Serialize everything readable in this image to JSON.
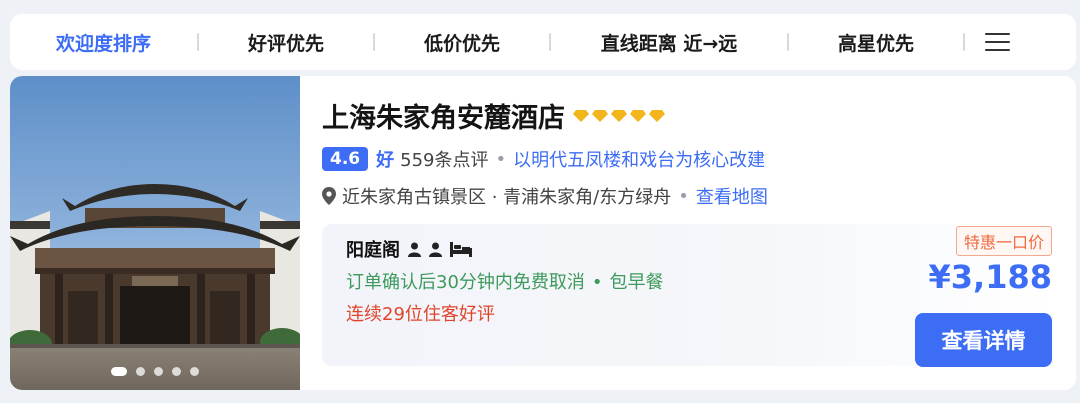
{
  "sort_bar": {
    "items": [
      {
        "label": "欢迎度排序",
        "active": true
      },
      {
        "label": "好评优先",
        "active": false
      },
      {
        "label": "低价优先",
        "active": false
      },
      {
        "label": "直线距离 近→远",
        "active": false
      },
      {
        "label": "高星优先",
        "active": false
      }
    ],
    "menu_icon": "hamburger-menu-icon"
  },
  "hotel": {
    "name": "上海朱家角安麓酒店",
    "diamond_count": 5,
    "diamond_color": "#f2b61c",
    "score": "4.6",
    "score_text": "好",
    "review_count": "559条点评",
    "highlight": "以明代五凤楼和戏台为核心改建",
    "location": "近朱家角古镇景区 · 青浦朱家角/东方绿舟",
    "map_link": "查看地图",
    "photo_dots": 5,
    "active_photo": 1
  },
  "room": {
    "name": "阳庭阁",
    "icons": [
      "person-icon",
      "person-icon",
      "bed-icon"
    ],
    "cancel_policy": "订单确认后30分钟内免费取消",
    "meal": "包早餐",
    "review_streak": "连续29位住客好评"
  },
  "price": {
    "tag": "特惠一口价",
    "amount": "¥3,188",
    "button_label": "查看详情"
  },
  "colors": {
    "accent": "#3d6df5",
    "green": "#3d9a5c",
    "red": "#e0452b",
    "orange": "#ef6a3f"
  }
}
